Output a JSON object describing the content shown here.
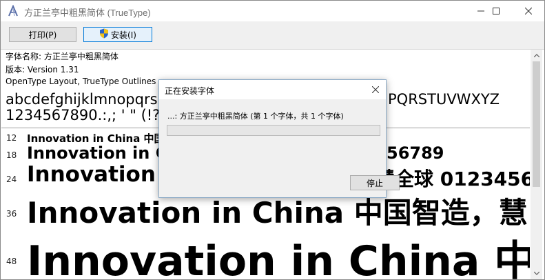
{
  "window": {
    "title": "方正兰亭中粗黑简体 (TrueType)"
  },
  "toolbar": {
    "print_label": "打印(P)",
    "install_label": "安装(I)"
  },
  "font_info": {
    "name_line": "字体名称: 方正兰亭中粗黑简体",
    "version_line": "版本: Version 1.31",
    "type_line": "OpenType Layout, TrueType Outlines",
    "alphabet_line1_left": "abcdefghijklmnopqrs",
    "alphabet_line1_right": "PQRSTUVWXYZ",
    "alphabet_line2": "1234567890.:,; ' \" (!?)"
  },
  "samples": [
    {
      "size": "12",
      "text": "Innovation in China 中国"
    },
    {
      "size": "18",
      "text": "Innovation in Ch",
      "tail": "56789"
    },
    {
      "size": "24",
      "text": "Innovation i",
      "tail": "慧全球 0123456"
    },
    {
      "size": "36",
      "text": "Innovation in China 中国智造，慧"
    },
    {
      "size": "48",
      "text": "Innovation in China 中国"
    }
  ],
  "dialog": {
    "title": "正在安装字体",
    "message": "...: 方正兰亭中粗黑简体 (第 1 个字体，共 1 个字体)",
    "progress": 0,
    "stop_label": "停止"
  },
  "colors": {
    "accent": "#0078d7",
    "progress_fill": "#06b025"
  }
}
